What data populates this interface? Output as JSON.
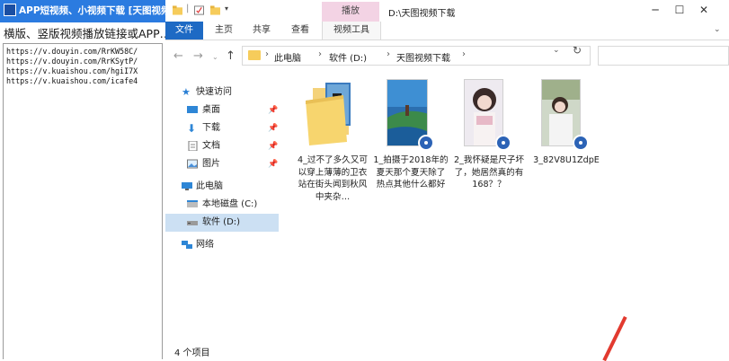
{
  "app": {
    "title": "APP短视频、小视频下载 [天图视频…",
    "banner": "横版、竖版视频播放链接或APP…",
    "links": [
      "https://v.douyin.com/RrKW58C/",
      "https://v.douyin.com/RrKSytP/",
      "https://v.kuaishou.com/hgiI7X",
      "https://v.kuaishou.com/icafe4"
    ]
  },
  "explorer": {
    "window_path": "D:\\天图视频下载",
    "ribbon_context_tab": "播放",
    "tabs": [
      "文件",
      "主页",
      "共享",
      "查看",
      "视频工具"
    ],
    "breadcrumbs": [
      "此电脑",
      "软件 (D:)",
      "天图视频下载"
    ],
    "nav": {
      "quick_access": "快速访问",
      "desktop": "桌面",
      "downloads": "下载",
      "documents": "文档",
      "pictures": "图片",
      "this_pc": "此电脑",
      "local_disk": "本地磁盘 (C:)",
      "software_d": "软件 (D:)",
      "network": "网络"
    },
    "files": [
      {
        "name": "4_过不了多久又可以穿上薄薄的卫衣站在街头闻到秋风中夹杂…",
        "type": "folder"
      },
      {
        "name": "1_拍摄于2018年的夏天那个夏天除了热点其他什么都好",
        "type": "video"
      },
      {
        "name": "2_我怀疑是尺子坏了，她居然真的有168？？",
        "type": "video"
      },
      {
        "name": "3_82V8U1ZdpE",
        "type": "video"
      }
    ],
    "status": "4 个项目"
  },
  "icons": {
    "back": "arrow-left-icon",
    "forward": "arrow-right-icon",
    "up": "arrow-up-icon",
    "refresh": "refresh-icon",
    "pin": "pin-icon"
  },
  "colors": {
    "titlebar": "#2b7be0",
    "file_tab": "#1e6ac4",
    "context_tab": "#f3d3e4",
    "selection": "#cce0f3"
  }
}
